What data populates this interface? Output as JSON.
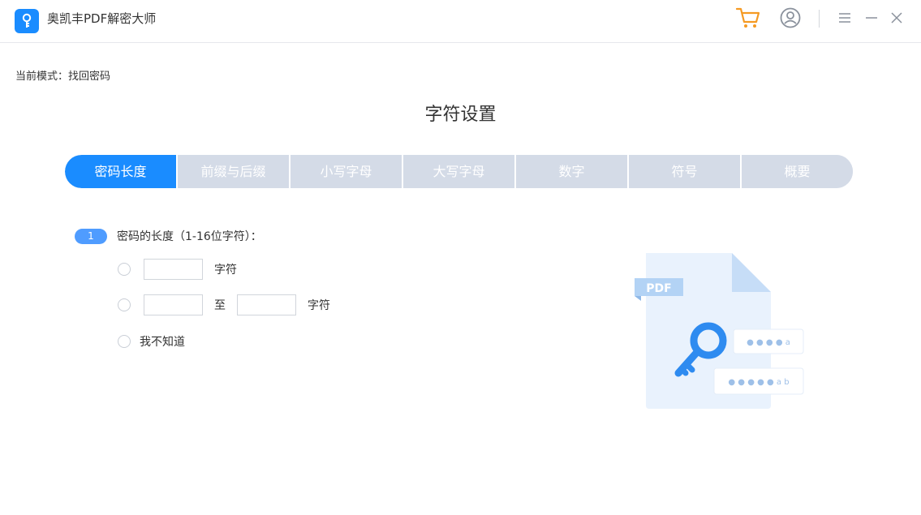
{
  "app": {
    "title": "奥凯丰PDF解密大师",
    "icon": "key-icon"
  },
  "titlebar": {
    "icons": [
      "cart-icon",
      "user-icon",
      "menu-icon",
      "minimize-icon",
      "close-icon"
    ],
    "cart_color": "#f59a23"
  },
  "mode": {
    "prefix": "当前模式：",
    "value": "找回密码"
  },
  "section_title": "字符设置",
  "tabs": [
    {
      "label": "密码长度",
      "active": true
    },
    {
      "label": "前缀与后缀",
      "active": false
    },
    {
      "label": "小写字母",
      "active": false
    },
    {
      "label": "大写字母",
      "active": false
    },
    {
      "label": "数字",
      "active": false
    },
    {
      "label": "符号",
      "active": false
    },
    {
      "label": "概要",
      "active": false
    }
  ],
  "step": {
    "number": "1",
    "label": "密码的长度（1-16位字符）："
  },
  "options": {
    "exact": {
      "value": "",
      "unit": "字符"
    },
    "range": {
      "from": "",
      "to_label": "至",
      "to": "",
      "unit": "字符"
    },
    "unknown": {
      "label": "我不知道"
    }
  },
  "illustration": {
    "badge": "PDF",
    "pw1": "● ● ● ● a",
    "pw2": "● ● ● ● ● a b"
  },
  "colors": {
    "accent": "#1a8cff",
    "tab_inactive": "#d4dbe7",
    "badge": "#4f9cff"
  }
}
